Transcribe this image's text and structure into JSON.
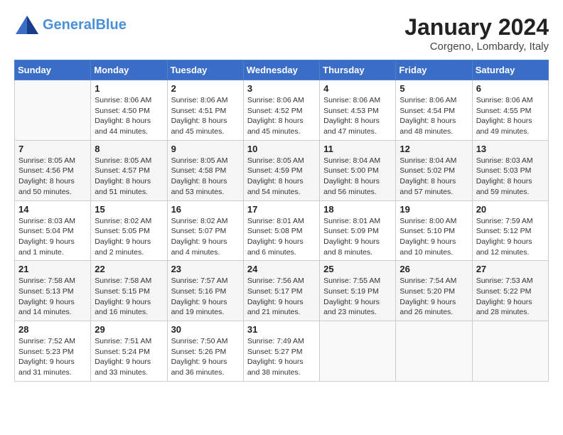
{
  "header": {
    "logo_line1": "General",
    "logo_line2": "Blue",
    "month_title": "January 2024",
    "location": "Corgeno, Lombardy, Italy"
  },
  "weekdays": [
    "Sunday",
    "Monday",
    "Tuesday",
    "Wednesday",
    "Thursday",
    "Friday",
    "Saturday"
  ],
  "weeks": [
    [
      {
        "day": "",
        "sunrise": "",
        "sunset": "",
        "daylight": ""
      },
      {
        "day": "1",
        "sunrise": "Sunrise: 8:06 AM",
        "sunset": "Sunset: 4:50 PM",
        "daylight": "Daylight: 8 hours and 44 minutes."
      },
      {
        "day": "2",
        "sunrise": "Sunrise: 8:06 AM",
        "sunset": "Sunset: 4:51 PM",
        "daylight": "Daylight: 8 hours and 45 minutes."
      },
      {
        "day": "3",
        "sunrise": "Sunrise: 8:06 AM",
        "sunset": "Sunset: 4:52 PM",
        "daylight": "Daylight: 8 hours and 45 minutes."
      },
      {
        "day": "4",
        "sunrise": "Sunrise: 8:06 AM",
        "sunset": "Sunset: 4:53 PM",
        "daylight": "Daylight: 8 hours and 47 minutes."
      },
      {
        "day": "5",
        "sunrise": "Sunrise: 8:06 AM",
        "sunset": "Sunset: 4:54 PM",
        "daylight": "Daylight: 8 hours and 48 minutes."
      },
      {
        "day": "6",
        "sunrise": "Sunrise: 8:06 AM",
        "sunset": "Sunset: 4:55 PM",
        "daylight": "Daylight: 8 hours and 49 minutes."
      }
    ],
    [
      {
        "day": "7",
        "sunrise": "Sunrise: 8:05 AM",
        "sunset": "Sunset: 4:56 PM",
        "daylight": "Daylight: 8 hours and 50 minutes."
      },
      {
        "day": "8",
        "sunrise": "Sunrise: 8:05 AM",
        "sunset": "Sunset: 4:57 PM",
        "daylight": "Daylight: 8 hours and 51 minutes."
      },
      {
        "day": "9",
        "sunrise": "Sunrise: 8:05 AM",
        "sunset": "Sunset: 4:58 PM",
        "daylight": "Daylight: 8 hours and 53 minutes."
      },
      {
        "day": "10",
        "sunrise": "Sunrise: 8:05 AM",
        "sunset": "Sunset: 4:59 PM",
        "daylight": "Daylight: 8 hours and 54 minutes."
      },
      {
        "day": "11",
        "sunrise": "Sunrise: 8:04 AM",
        "sunset": "Sunset: 5:00 PM",
        "daylight": "Daylight: 8 hours and 56 minutes."
      },
      {
        "day": "12",
        "sunrise": "Sunrise: 8:04 AM",
        "sunset": "Sunset: 5:02 PM",
        "daylight": "Daylight: 8 hours and 57 minutes."
      },
      {
        "day": "13",
        "sunrise": "Sunrise: 8:03 AM",
        "sunset": "Sunset: 5:03 PM",
        "daylight": "Daylight: 8 hours and 59 minutes."
      }
    ],
    [
      {
        "day": "14",
        "sunrise": "Sunrise: 8:03 AM",
        "sunset": "Sunset: 5:04 PM",
        "daylight": "Daylight: 9 hours and 1 minute."
      },
      {
        "day": "15",
        "sunrise": "Sunrise: 8:02 AM",
        "sunset": "Sunset: 5:05 PM",
        "daylight": "Daylight: 9 hours and 2 minutes."
      },
      {
        "day": "16",
        "sunrise": "Sunrise: 8:02 AM",
        "sunset": "Sunset: 5:07 PM",
        "daylight": "Daylight: 9 hours and 4 minutes."
      },
      {
        "day": "17",
        "sunrise": "Sunrise: 8:01 AM",
        "sunset": "Sunset: 5:08 PM",
        "daylight": "Daylight: 9 hours and 6 minutes."
      },
      {
        "day": "18",
        "sunrise": "Sunrise: 8:01 AM",
        "sunset": "Sunset: 5:09 PM",
        "daylight": "Daylight: 9 hours and 8 minutes."
      },
      {
        "day": "19",
        "sunrise": "Sunrise: 8:00 AM",
        "sunset": "Sunset: 5:10 PM",
        "daylight": "Daylight: 9 hours and 10 minutes."
      },
      {
        "day": "20",
        "sunrise": "Sunrise: 7:59 AM",
        "sunset": "Sunset: 5:12 PM",
        "daylight": "Daylight: 9 hours and 12 minutes."
      }
    ],
    [
      {
        "day": "21",
        "sunrise": "Sunrise: 7:58 AM",
        "sunset": "Sunset: 5:13 PM",
        "daylight": "Daylight: 9 hours and 14 minutes."
      },
      {
        "day": "22",
        "sunrise": "Sunrise: 7:58 AM",
        "sunset": "Sunset: 5:15 PM",
        "daylight": "Daylight: 9 hours and 16 minutes."
      },
      {
        "day": "23",
        "sunrise": "Sunrise: 7:57 AM",
        "sunset": "Sunset: 5:16 PM",
        "daylight": "Daylight: 9 hours and 19 minutes."
      },
      {
        "day": "24",
        "sunrise": "Sunrise: 7:56 AM",
        "sunset": "Sunset: 5:17 PM",
        "daylight": "Daylight: 9 hours and 21 minutes."
      },
      {
        "day": "25",
        "sunrise": "Sunrise: 7:55 AM",
        "sunset": "Sunset: 5:19 PM",
        "daylight": "Daylight: 9 hours and 23 minutes."
      },
      {
        "day": "26",
        "sunrise": "Sunrise: 7:54 AM",
        "sunset": "Sunset: 5:20 PM",
        "daylight": "Daylight: 9 hours and 26 minutes."
      },
      {
        "day": "27",
        "sunrise": "Sunrise: 7:53 AM",
        "sunset": "Sunset: 5:22 PM",
        "daylight": "Daylight: 9 hours and 28 minutes."
      }
    ],
    [
      {
        "day": "28",
        "sunrise": "Sunrise: 7:52 AM",
        "sunset": "Sunset: 5:23 PM",
        "daylight": "Daylight: 9 hours and 31 minutes."
      },
      {
        "day": "29",
        "sunrise": "Sunrise: 7:51 AM",
        "sunset": "Sunset: 5:24 PM",
        "daylight": "Daylight: 9 hours and 33 minutes."
      },
      {
        "day": "30",
        "sunrise": "Sunrise: 7:50 AM",
        "sunset": "Sunset: 5:26 PM",
        "daylight": "Daylight: 9 hours and 36 minutes."
      },
      {
        "day": "31",
        "sunrise": "Sunrise: 7:49 AM",
        "sunset": "Sunset: 5:27 PM",
        "daylight": "Daylight: 9 hours and 38 minutes."
      },
      {
        "day": "",
        "sunrise": "",
        "sunset": "",
        "daylight": ""
      },
      {
        "day": "",
        "sunrise": "",
        "sunset": "",
        "daylight": ""
      },
      {
        "day": "",
        "sunrise": "",
        "sunset": "",
        "daylight": ""
      }
    ]
  ]
}
